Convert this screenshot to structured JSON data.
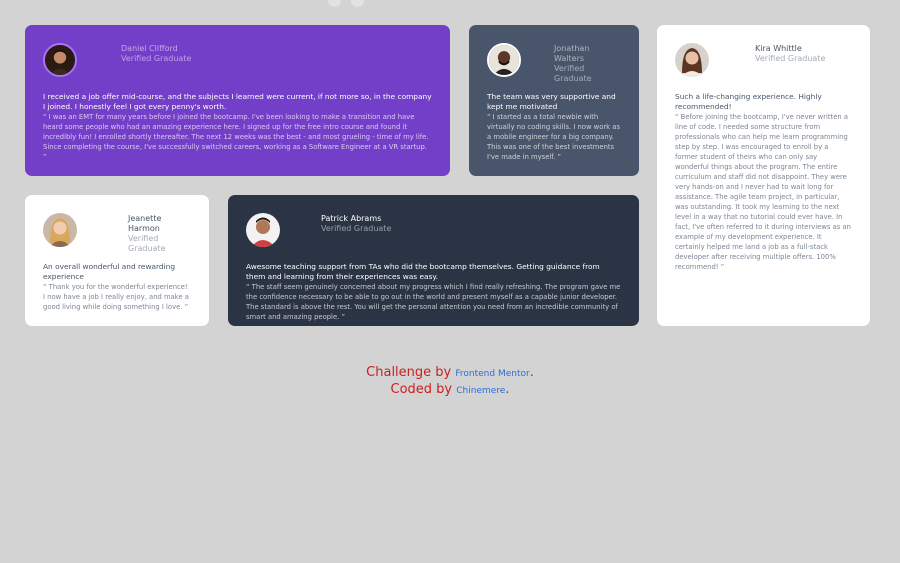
{
  "testimonials": [
    {
      "name": "Daniel Clifford",
      "role": "Verified Graduate",
      "headline": "I received a job offer mid-course, and the subjects I learned were current, if not more so, in the company I joined. I honestly feel I got every penny's worth.",
      "body": "“ I was an EMT for many years before I joined the bootcamp. I've been looking to make a transition and have heard some people who had an amazing experience here. I signed up for the free intro course and found it incredibly fun! I enrolled shortly thereafter. The next 12 weeks was the best - and most grueling - time of my life. Since completing the course, I've successfully switched careers, working as a Software Engineer at a VR startup. ”"
    },
    {
      "name": "Jonathan Walters",
      "role": "Verified Graduate",
      "headline": "The team was very supportive and kept me motivated",
      "body": "“ I started as a total newbie with virtually no coding skills. I now work as a mobile engineer for a big company. This was one of the best investments I've made in myself. ”"
    },
    {
      "name": "Kira Whittle",
      "role": "Verified Graduate",
      "headline": "Such a life-changing experience. Highly recommended!",
      "body": "“ Before joining the bootcamp, I've never written a line of code. I needed some structure from professionals who can help me learn programming step by step. I was encouraged to enroll by a former student of theirs who can only say wonderful things about the program. The entire curriculum and staff did not disappoint. They were very hands-on and I never had to wait long for assistance. The agile team project, in particular, was outstanding. It took my learning to the next level in a way that no tutorial could ever have. In fact, I've often referred to it during interviews as an example of my development experience. It certainly helped me land a job as a full-stack developer after receiving multiple offers. 100% recommend! ”"
    },
    {
      "name": "Jeanette Harmon",
      "role": "Verified Graduate",
      "headline": "An overall wonderful and rewarding experience",
      "body": "“ Thank you for the wonderful experience! I now have a job I really enjoy, and make a good living while doing something I love. ”"
    },
    {
      "name": "Patrick Abrams",
      "role": "Verified Graduate",
      "headline": "Awesome teaching support from TAs who did the bootcamp themselves. Getting guidance from them and learning from their experiences was easy.",
      "body": "“ The staff seem genuinely concerned about my progress which I find really refreshing. The program gave me the confidence necessary to be able to go out in the world and present myself as a capable junior developer. The standard is above the rest. You will get the personal attention you need from an incredible community of smart and amazing people. ”"
    }
  ],
  "attribution": {
    "challenge_prefix": "Challenge by",
    "challenge_link": "Frontend Mentor",
    "coded_prefix": "Coded by",
    "coded_link": "Chinemere",
    "suffix": "."
  },
  "colors": {
    "purple": "#733fc8",
    "slate": "#48556a",
    "dark": "#2b3445",
    "white": "#ffffff",
    "background": "#d3d3d3"
  }
}
